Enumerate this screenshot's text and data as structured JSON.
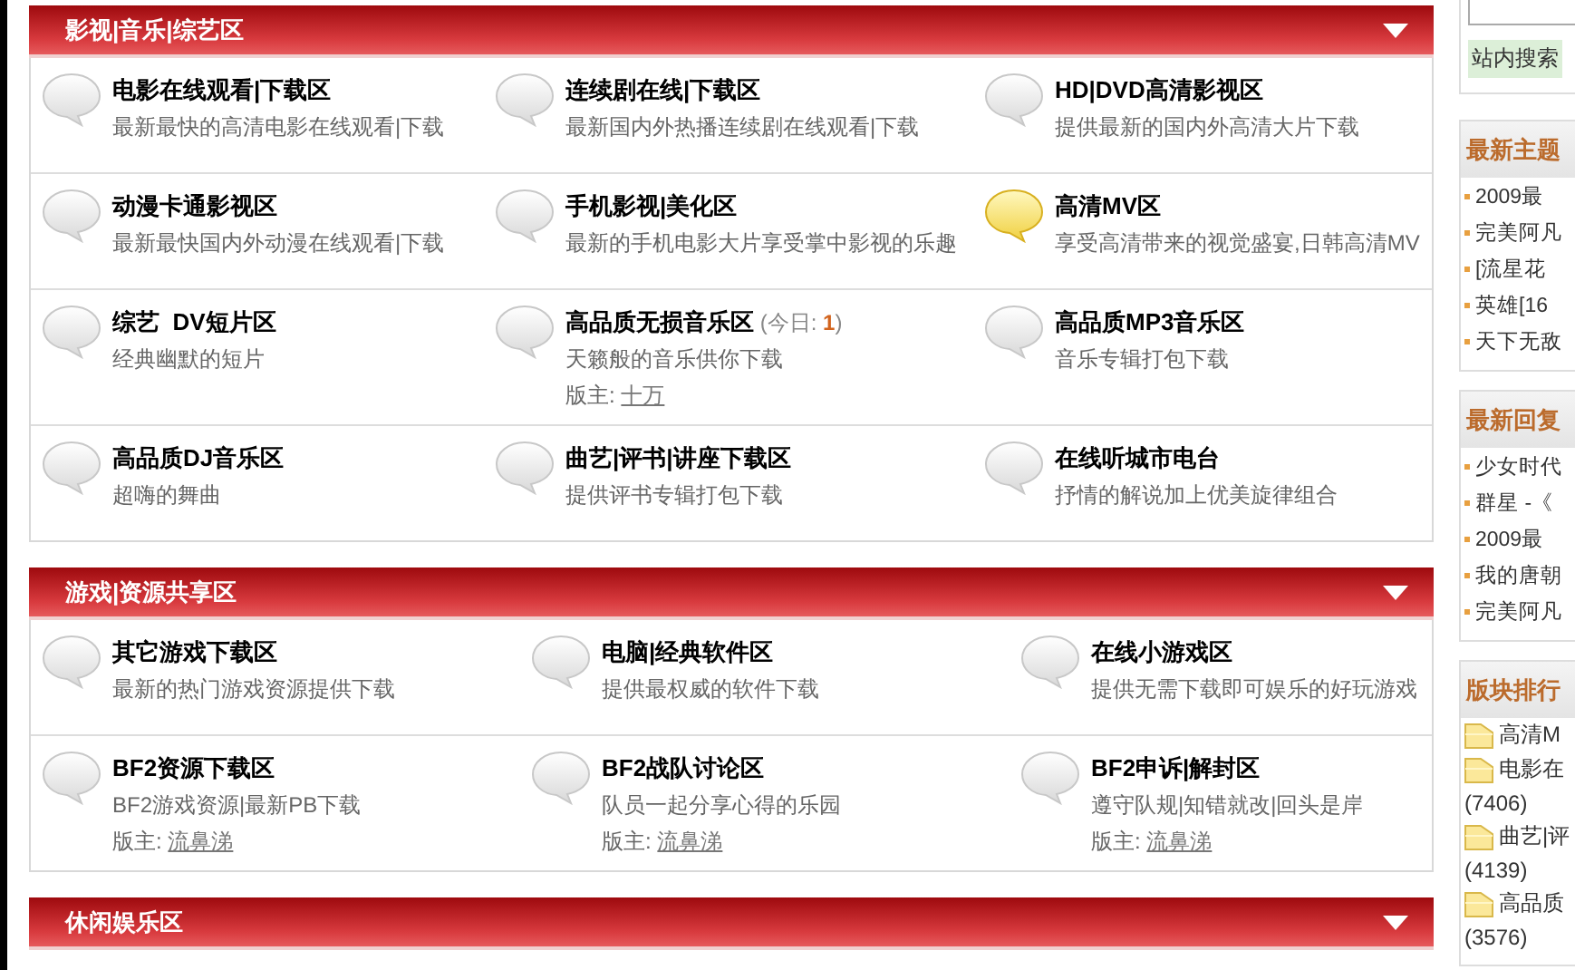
{
  "sections": [
    {
      "title": "影视|音乐|综艺区",
      "collapsible": true,
      "forums": [
        {
          "name": "电影在线观看|下载区",
          "description": "最新最快的高清电影在线观看|下载",
          "has_new": false
        },
        {
          "name": "连续剧在线|下载区",
          "description": "最新国内外热播连续剧在线观看|下载",
          "has_new": false
        },
        {
          "name": "HD|DVD高清影视区",
          "description": "提供最新的国内外高清大片下载",
          "has_new": false
        },
        {
          "name": "动漫卡通影视区",
          "description": "最新最快国内外动漫在线观看|下载",
          "has_new": false
        },
        {
          "name": "手机影视|美化区",
          "description": "最新的手机电影大片享受掌中影视的乐趣",
          "has_new": false
        },
        {
          "name": "高清MV区",
          "description": "享受高清带来的视觉盛宴,日韩高清MV",
          "has_new": true
        },
        {
          "name": "综艺  DV短片区",
          "description": "经典幽默的短片",
          "has_new": false
        },
        {
          "name": "高品质无损音乐区",
          "today_label": "(今日: ",
          "today": "1",
          "today_end": ")",
          "description": "天籁般的音乐供你下载",
          "moderator_label": "版主:",
          "moderator": "十万",
          "has_new": false
        },
        {
          "name": "高品质MP3音乐区",
          "description": "音乐专辑打包下载",
          "has_new": false
        },
        {
          "name": "高品质DJ音乐区",
          "description": "超嗨的舞曲",
          "has_new": false
        },
        {
          "name": "曲艺|评书|讲座下载区",
          "description": "提供评书专辑打包下载",
          "has_new": false
        },
        {
          "name": "在线听城市电台",
          "description": "抒情的解说加上优美旋律组合",
          "has_new": false
        }
      ]
    },
    {
      "title": "游戏|资源共享区",
      "collapsible": true,
      "forums": [
        {
          "name": "其它游戏下载区",
          "description": "最新的热门游戏资源提供下载",
          "has_new": false
        },
        {
          "name": "电脑|经典软件区",
          "description": "提供最权威的软件下载",
          "has_new": false
        },
        {
          "name": "在线小游戏区",
          "description": "提供无需下载即可娱乐的好玩游戏",
          "has_new": false
        },
        {
          "name": "BF2资源下载区",
          "description": "BF2游戏资源|最新PB下载",
          "moderator_label": "版主:",
          "moderator": "流鼻涕",
          "has_new": false
        },
        {
          "name": "BF2战队讨论区",
          "description": "队员一起分享心得的乐园",
          "moderator_label": "版主:",
          "moderator": "流鼻涕",
          "has_new": false
        },
        {
          "name": "BF2申诉|解封区",
          "description": "遵守队规|知错就改|回头是岸",
          "moderator_label": "版主:",
          "moderator": "流鼻涕",
          "has_new": false
        }
      ]
    },
    {
      "title": "休闲娱乐区",
      "collapsible": true
    }
  ],
  "sidebar": {
    "search_button": "站内搜索",
    "panels": [
      {
        "kind": "list",
        "title": "最新主题",
        "items": [
          {
            "text": "2009最"
          },
          {
            "text": "完美阿凡"
          },
          {
            "text": "[流星花"
          },
          {
            "text": "英雄[16"
          },
          {
            "text": "天下无敌"
          }
        ]
      },
      {
        "kind": "list",
        "title": "最新回复",
        "items": [
          {
            "text": "少女时代"
          },
          {
            "text": "群星 -《"
          },
          {
            "text": "2009最"
          },
          {
            "text": "我的唐朝"
          },
          {
            "text": "完美阿凡"
          }
        ]
      },
      {
        "kind": "ranking",
        "title": "版块排行",
        "items": [
          {
            "text": "高清M"
          },
          {
            "text": "电影在",
            "count": "(7406)"
          },
          {
            "text": "曲艺|评",
            "count": "(4139)"
          },
          {
            "text": "高品质",
            "count": "(3576)"
          }
        ]
      }
    ]
  }
}
